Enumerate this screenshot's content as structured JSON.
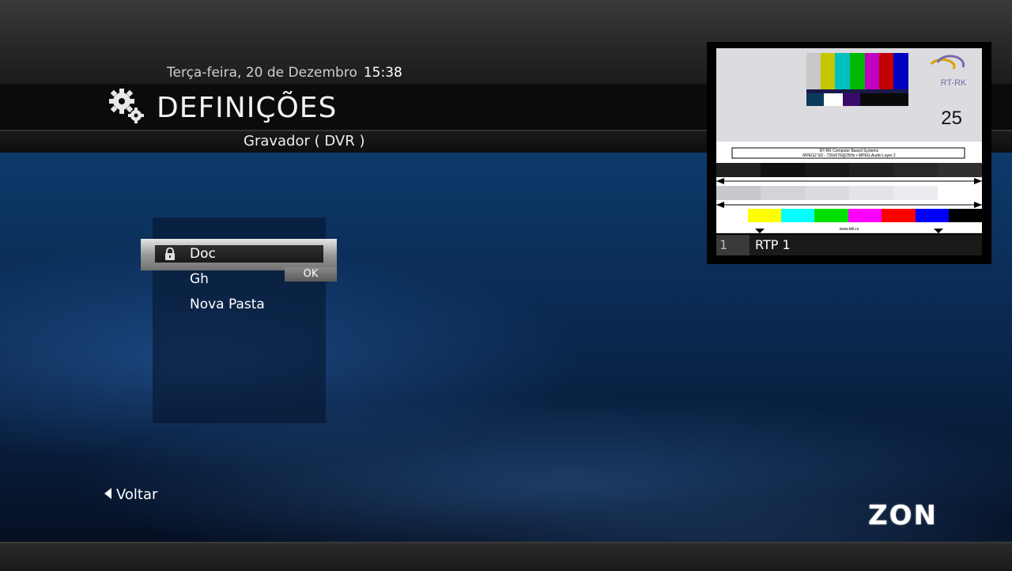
{
  "header": {
    "date": "Terça-feira, 20 de Dezembro",
    "time": "15:38",
    "title": "DEFINIÇÕES",
    "subtitle": "Gravador ( DVR )"
  },
  "folder_list": {
    "items": [
      {
        "label": "Doc",
        "locked": true,
        "selected": true
      },
      {
        "label": "Gh",
        "locked": false,
        "selected": false
      },
      {
        "label": "Nova Pasta",
        "locked": false,
        "selected": false
      }
    ],
    "ok_label": "OK"
  },
  "preview": {
    "channel_number": "1",
    "channel_name": "RTP 1",
    "test_card": {
      "logo_text": "RT-RK",
      "logo_sub": "COMPUTER BASED SYSTEMS",
      "counter": "25",
      "caption_line1": "RT-RK Computer Based Systems",
      "caption_line2": "MPEG2 SD - 720x576@25Hz • MPEG Audio Layer 2",
      "footer": "www.bbt.rs"
    }
  },
  "footer": {
    "back_label": "Voltar",
    "brand": "ZON"
  },
  "colors": {
    "accent_blue": "#0e3a6c",
    "bar_dark": "#0b0b0b"
  }
}
